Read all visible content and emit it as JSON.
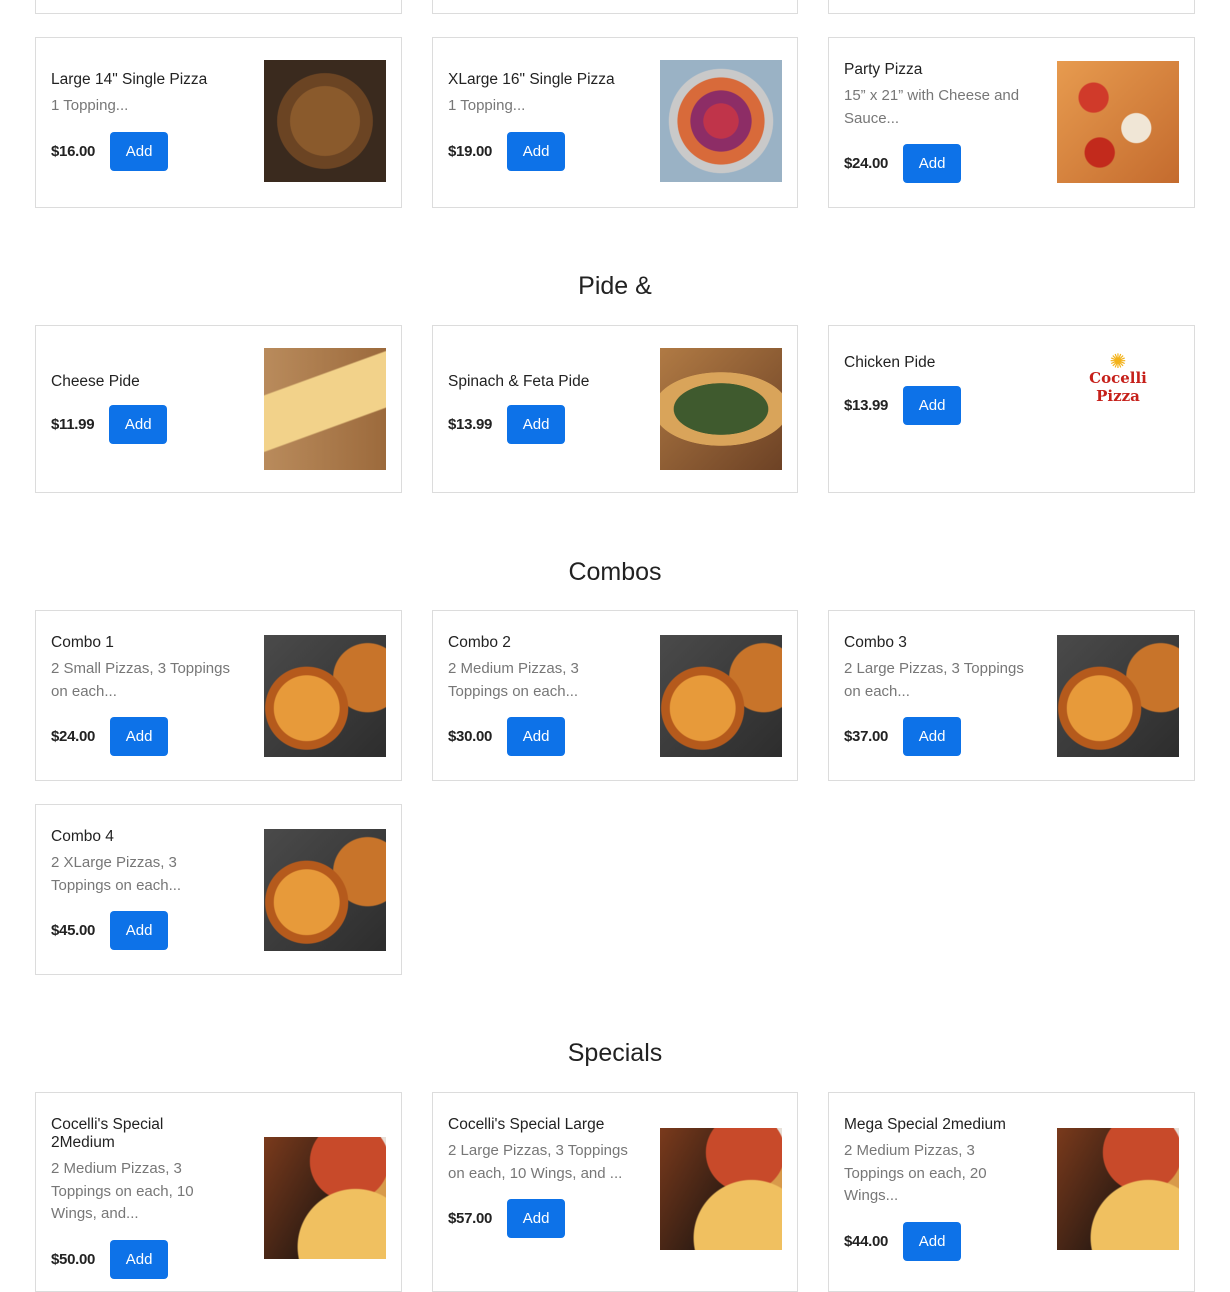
{
  "top_row": [
    {
      "name": "Large 14\" Single Pizza",
      "desc": "1 Topping...",
      "price": "$16.00",
      "add": "Add",
      "image": "pizza-photo"
    },
    {
      "name": "XLarge 16\" Single Pizza",
      "desc": "1 Topping...",
      "price": "$19.00",
      "add": "Add",
      "image": "pizza-photo"
    },
    {
      "name": "Party Pizza",
      "desc": "15” x 21” with Cheese and Sauce...",
      "price": "$24.00",
      "add": "Add",
      "image": "pizza-photo"
    }
  ],
  "sections": {
    "pide": {
      "title": "Pide &",
      "items": [
        {
          "name": "Cheese Pide",
          "price": "$11.99",
          "add": "Add",
          "image": "pide-photo"
        },
        {
          "name": "Spinach & Feta Pide",
          "price": "$13.99",
          "add": "Add",
          "image": "pide-photo"
        },
        {
          "name": "Chicken Pide",
          "price": "$13.99",
          "add": "Add",
          "image": "cocelli-pizza-logo",
          "logo_text": "Cocelli Pizza"
        }
      ]
    },
    "combos": {
      "title": "Combos",
      "items": [
        {
          "name": "Combo 1",
          "desc": "2 Small Pizzas, 3 Toppings on each...",
          "price": "$24.00",
          "add": "Add"
        },
        {
          "name": "Combo 2",
          "desc": "2 Medium Pizzas, 3 Toppings on each...",
          "price": "$30.00",
          "add": "Add"
        },
        {
          "name": "Combo 3",
          "desc": "2 Large Pizzas, 3 Toppings on each...",
          "price": "$37.00",
          "add": "Add"
        },
        {
          "name": "Combo 4",
          "desc": "2 XLarge Pizzas, 3 Toppings on each...",
          "price": "$45.00",
          "add": "Add"
        }
      ]
    },
    "specials": {
      "title": "Specials",
      "items": [
        {
          "name": "Cocelli's Special 2Medium",
          "desc": "2 Medium Pizzas, 3 Toppings on each, 10 Wings, and...",
          "price": "$50.00",
          "add": "Add"
        },
        {
          "name": "Cocelli's Special Large",
          "desc": "2 Large Pizzas, 3 Toppings on each, 10 Wings, and ...",
          "price": "$57.00",
          "add": "Add"
        },
        {
          "name": "Mega Special 2medium",
          "desc": "2 Medium Pizzas, 3 Toppings on each, 20 Wings...",
          "price": "$44.00",
          "add": "Add"
        }
      ]
    }
  },
  "colors": {
    "accent": "#0d72e8",
    "border": "#dcdcdc",
    "muted_text": "#777777"
  }
}
